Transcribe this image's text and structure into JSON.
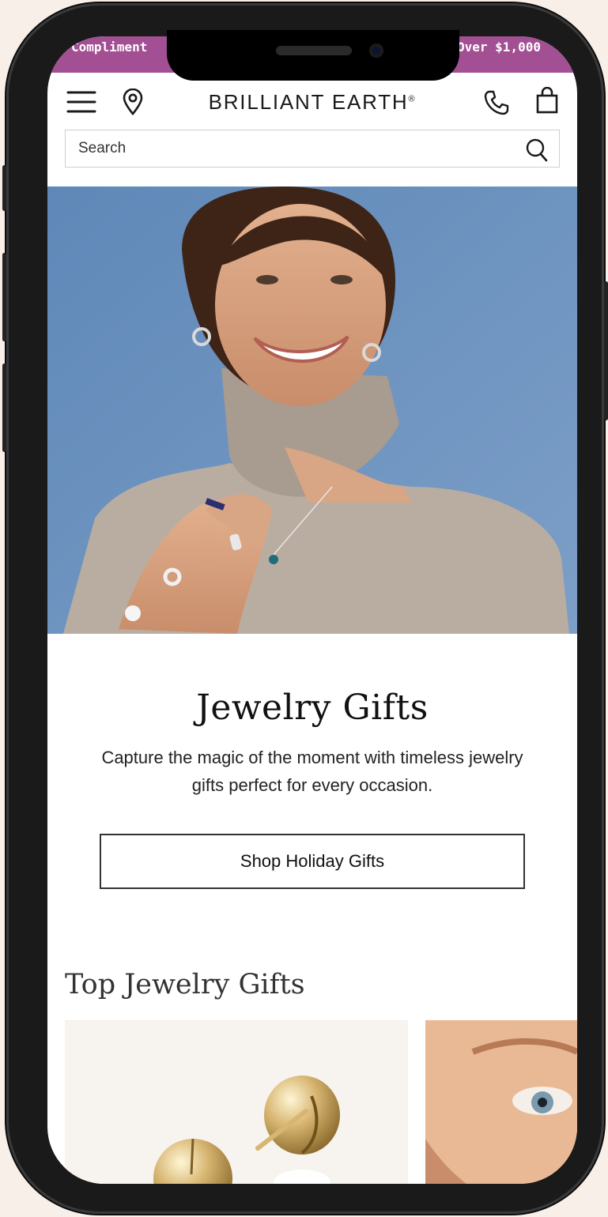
{
  "promo": {
    "left_text": "Compliment",
    "right_text": "Over $1,000"
  },
  "header": {
    "logo": "BRILLIANT EARTH",
    "logo_mark": "®"
  },
  "search": {
    "placeholder": "Search"
  },
  "hero": {
    "title": "Jewelry Gifts",
    "subtitle": "Capture the magic of the moment with timeless jewelry gifts perfect for every occasion.",
    "cta_label": "Shop Holiday Gifts"
  },
  "section": {
    "title": "Top Jewelry Gifts"
  },
  "colors": {
    "promo_bg": "#a34f93",
    "hero_bg": "#6d93be"
  }
}
